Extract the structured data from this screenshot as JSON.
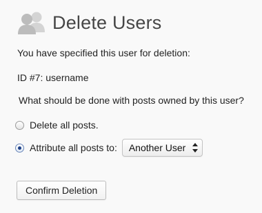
{
  "header": {
    "title": "Delete Users",
    "icon": "users-icon"
  },
  "content": {
    "intro": "You have specified this user for deletion:",
    "user_line": "ID #7: username",
    "question": "What should be done with posts owned by this user?"
  },
  "options": {
    "delete_label": "Delete all posts.",
    "attribute_label": "Attribute all posts to:",
    "selected": "attribute",
    "attribute_select_value": "Another User"
  },
  "actions": {
    "confirm_label": "Confirm Deletion"
  }
}
